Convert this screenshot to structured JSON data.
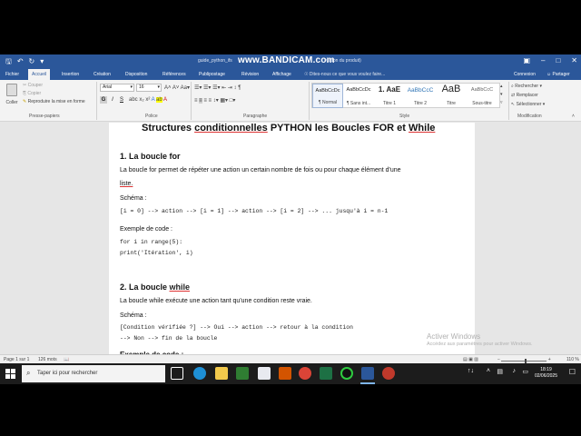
{
  "titlebar": {
    "doc_title": "guide_python_ifs",
    "bandicam": "www.BANDICAM.com",
    "doc_title_tail": "ivation du produit)"
  },
  "tabs": [
    {
      "label": "Fichier",
      "active": false
    },
    {
      "label": "Accueil",
      "active": true
    },
    {
      "label": "Insertion",
      "active": false
    },
    {
      "label": "Création",
      "active": false
    },
    {
      "label": "Disposition",
      "active": false
    },
    {
      "label": "Références",
      "active": false
    },
    {
      "label": "Publipostage",
      "active": false
    },
    {
      "label": "Révision",
      "active": false
    },
    {
      "label": "Affichage",
      "active": false
    }
  ],
  "tell_me": "Dites-nous ce que vous voulez faire...",
  "account": {
    "signin": "Connexion",
    "share": "Partager"
  },
  "ribbon": {
    "clipboard": {
      "paste": "Coller",
      "cut": "Couper",
      "copy": "Copier",
      "format_painter": "Reproduire la mise en forme",
      "label": "Presse-papiers"
    },
    "font": {
      "family": "Arial",
      "size": "16",
      "bold": "G",
      "italic": "I",
      "underline": "S",
      "label": "Police"
    },
    "paragraph": {
      "label": "Paragraphe"
    },
    "styles": {
      "label": "Style",
      "items": [
        {
          "sample": "AaBbCcDc",
          "name": "¶ Normal"
        },
        {
          "sample": "AaBbCcDc",
          "name": "¶ Sans int..."
        },
        {
          "sample": "1. AaE",
          "name": "Titre 1"
        },
        {
          "sample": "AaBbCcC",
          "name": "Titre 2"
        },
        {
          "sample": "AaB",
          "name": "Titre"
        },
        {
          "sample": "AaBbCcC",
          "name": "Sous-titre"
        }
      ]
    },
    "editing": {
      "find": "Rechercher",
      "replace": "Remplacer",
      "select": "Sélectionner",
      "label": "Modification"
    }
  },
  "document": {
    "title_parts": [
      "Structures ",
      "conditionnelles",
      " PYTHON les Boucles FOR et ",
      "While"
    ],
    "section1": {
      "heading": "1. La boucle for",
      "text1": "La boucle for permet de répéter une action un certain nombre de fois ou pour chaque élément d'une",
      "text2": "liste.",
      "schema_label": "Schéma :",
      "schema_code": "[i = 0] --> action --> [i = 1] --> action --> [i = 2] --> ... jusqu'à i = n-1",
      "example_label": "Exemple de code :",
      "code1": "for i in range(5):",
      "code2": "print('Itération', i)"
    },
    "section2": {
      "heading_prefix": "2. La boucle ",
      "heading_kw": "while",
      "text": "La boucle while exécute une action tant qu'une condition reste vraie.",
      "schema_label": "Schéma :",
      "code1": "[Condition vérifiée ?] --> Oui --> action --> retour à la condition",
      "code2": "--> Non --> fin de la boucle",
      "next_partial": "Exemple de code :"
    }
  },
  "watermark": {
    "line1": "Activer Windows",
    "line2": "Accédez aux paramètres pour activer Windows."
  },
  "statusbar": {
    "page": "Page 1 sur 1",
    "words": "126 mots",
    "zoom": "110 %"
  },
  "taskbar": {
    "search_placeholder": "Taper ici pour rechercher",
    "time": "18:19",
    "date": "02/06/2025"
  }
}
